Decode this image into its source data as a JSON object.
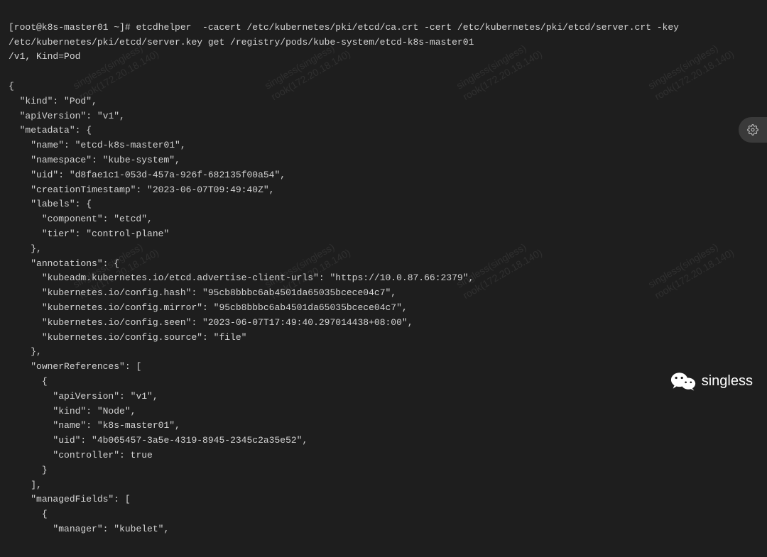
{
  "prompt": "[root@k8s-master01 ~]# ",
  "command": "etcdhelper  -cacert /etc/kubernetes/pki/etcd/ca.crt -cert /etc/kubernetes/pki/etcd/server.crt -key /etc/kubernetes/pki/etcd/server.key get /registry/pods/kube-system/etcd-k8s-master01",
  "output_header": "/v1, Kind=Pod",
  "json_lines": [
    "{",
    "  \"kind\": \"Pod\",",
    "  \"apiVersion\": \"v1\",",
    "  \"metadata\": {",
    "    \"name\": \"etcd-k8s-master01\",",
    "    \"namespace\": \"kube-system\",",
    "    \"uid\": \"d8fae1c1-053d-457a-926f-682135f00a54\",",
    "    \"creationTimestamp\": \"2023-06-07T09:49:40Z\",",
    "    \"labels\": {",
    "      \"component\": \"etcd\",",
    "      \"tier\": \"control-plane\"",
    "    },",
    "    \"annotations\": {",
    "      \"kubeadm.kubernetes.io/etcd.advertise-client-urls\": \"https://10.0.87.66:2379\",",
    "      \"kubernetes.io/config.hash\": \"95cb8bbbc6ab4501da65035bcece04c7\",",
    "      \"kubernetes.io/config.mirror\": \"95cb8bbbc6ab4501da65035bcece04c7\",",
    "      \"kubernetes.io/config.seen\": \"2023-06-07T17:49:40.297014438+08:00\",",
    "      \"kubernetes.io/config.source\": \"file\"",
    "    },",
    "    \"ownerReferences\": [",
    "      {",
    "        \"apiVersion\": \"v1\",",
    "        \"kind\": \"Node\",",
    "        \"name\": \"k8s-master01\",",
    "        \"uid\": \"4b065457-3a5e-4319-8945-2345c2a35e52\",",
    "        \"controller\": true",
    "      }",
    "    ],",
    "    \"managedFields\": [",
    "      {",
    "        \"manager\": \"kubelet\","
  ],
  "watermark_line1": "singless(singless)",
  "watermark_line2": "rook(172.20.18.140)",
  "signature": "singless"
}
